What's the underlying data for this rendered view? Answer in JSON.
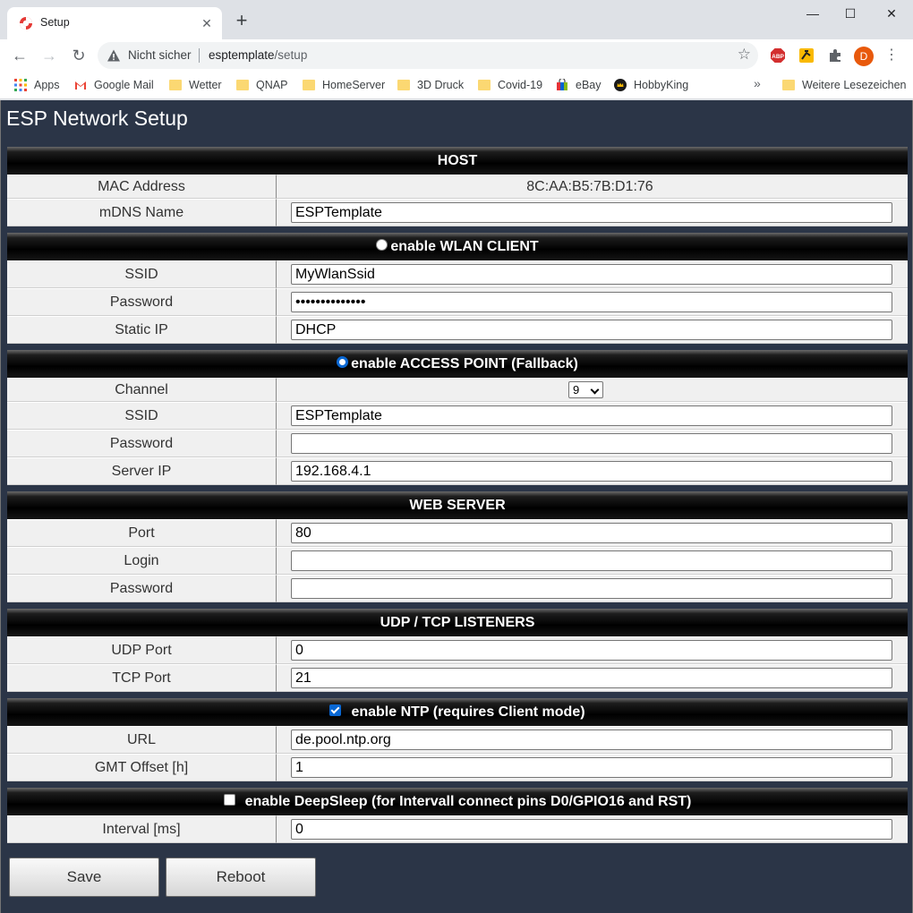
{
  "browser": {
    "tab_title": "Setup",
    "tab_close": "✕",
    "new_tab": "+",
    "win_min": "—",
    "win_max": "☐",
    "win_close": "✕",
    "security_label": "Nicht sicher",
    "url_host": "esptemplate",
    "url_path": "/setup",
    "profile_initial": "D",
    "bookmarks": [
      {
        "label": "Apps",
        "icon": "apps-grid-icon"
      },
      {
        "label": "Google Mail",
        "icon": "gmail-icon"
      },
      {
        "label": "Wetter",
        "icon": "folder-icon"
      },
      {
        "label": "QNAP",
        "icon": "folder-icon"
      },
      {
        "label": "HomeServer",
        "icon": "folder-icon"
      },
      {
        "label": "3D Druck",
        "icon": "folder-icon"
      },
      {
        "label": "Covid-19",
        "icon": "folder-icon"
      },
      {
        "label": "eBay",
        "icon": "ebay-icon"
      },
      {
        "label": "HobbyKing",
        "icon": "hobbyking-icon"
      }
    ],
    "bookmarks_more": "»",
    "other_bookmarks": "Weitere Lesezeichen",
    "colors": {
      "tab_strip": "#dee1e6",
      "page_bg": "#2b3547",
      "accent": "#0a68d4"
    }
  },
  "page": {
    "title": "ESP Network Setup",
    "host": {
      "header": "HOST",
      "mac_label": "MAC Address",
      "mac_value": "8C:AA:B5:7B:D1:76",
      "mdns_label": "mDNS Name",
      "mdns_value": "ESPTemplate"
    },
    "wlan": {
      "header": "enable WLAN CLIENT",
      "selected": false,
      "ssid_label": "SSID",
      "ssid_value": "MyWlanSsid",
      "password_label": "Password",
      "password_value": "••••••••••••••",
      "static_ip_label": "Static IP",
      "static_ip_value": "DHCP"
    },
    "ap": {
      "header": "enable ACCESS POINT (Fallback)",
      "selected": true,
      "channel_label": "Channel",
      "channel_value": "9",
      "ssid_label": "SSID",
      "ssid_value": "ESPTemplate",
      "password_label": "Password",
      "password_value": "",
      "server_ip_label": "Server IP",
      "server_ip_value": "192.168.4.1"
    },
    "web": {
      "header": "WEB SERVER",
      "port_label": "Port",
      "port_value": "80",
      "login_label": "Login",
      "login_value": "",
      "password_label": "Password",
      "password_value": ""
    },
    "listeners": {
      "header": "UDP / TCP LISTENERS",
      "udp_label": "UDP Port",
      "udp_value": "0",
      "tcp_label": "TCP Port",
      "tcp_value": "21"
    },
    "ntp": {
      "header": "enable NTP (requires Client mode)",
      "checked": true,
      "url_label": "URL",
      "url_value": "de.pool.ntp.org",
      "gmt_label": "GMT Offset [h]",
      "gmt_value": "1"
    },
    "deepsleep": {
      "header": "enable DeepSleep (for Intervall connect pins D0/GPIO16 and RST)",
      "checked": false,
      "interval_label": "Interval [ms]",
      "interval_value": "0"
    },
    "save_label": "Save",
    "reboot_label": "Reboot"
  }
}
